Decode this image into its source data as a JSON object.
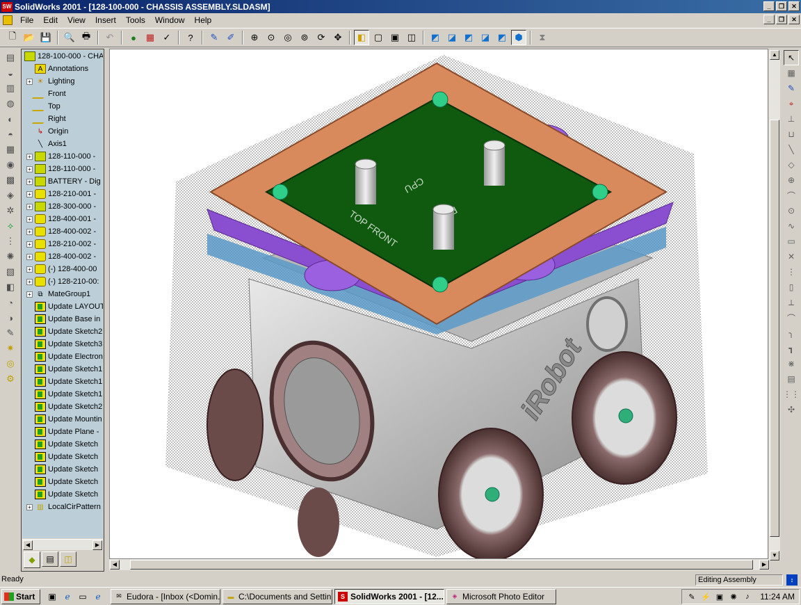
{
  "window": {
    "title": "SolidWorks 2001 - [128-100-000 - CHASSIS ASSEMBLY.SLDASM]",
    "app_icon": "SW"
  },
  "menu": [
    "File",
    "Edit",
    "View",
    "Insert",
    "Tools",
    "Window",
    "Help"
  ],
  "tree": {
    "root": "128-100-000 - CHA",
    "items": [
      {
        "label": "Annotations",
        "icon": "annotations-icon",
        "expand": false
      },
      {
        "label": "Lighting",
        "icon": "lighting-icon",
        "expand": true
      },
      {
        "label": "Front",
        "icon": "plane-icon",
        "expand": false
      },
      {
        "label": "Top",
        "icon": "plane-icon",
        "expand": false
      },
      {
        "label": "Right",
        "icon": "plane-icon",
        "expand": false
      },
      {
        "label": "Origin",
        "icon": "origin-icon",
        "expand": false
      },
      {
        "label": "Axis1",
        "icon": "axis-icon",
        "expand": false
      },
      {
        "label": "128-110-000 -",
        "icon": "subassembly-icon",
        "expand": true
      },
      {
        "label": "128-110-000 -",
        "icon": "subassembly-icon",
        "expand": true
      },
      {
        "label": "BATTERY - Dig",
        "icon": "subassembly-icon",
        "expand": true
      },
      {
        "label": "128-210-001 -",
        "icon": "part-icon",
        "expand": true
      },
      {
        "label": "128-300-000 -",
        "icon": "subassembly-icon",
        "expand": true
      },
      {
        "label": "128-400-001 -",
        "icon": "part-icon",
        "expand": true
      },
      {
        "label": "128-400-002 -",
        "icon": "part-icon",
        "expand": true
      },
      {
        "label": "128-210-002 -",
        "icon": "part-icon",
        "expand": true
      },
      {
        "label": "128-400-002 -",
        "icon": "part-icon",
        "expand": true
      },
      {
        "label": "(-) 128-400-00",
        "icon": "part-icon",
        "expand": true
      },
      {
        "label": "(-) 128-210-00:",
        "icon": "part-icon",
        "expand": true
      },
      {
        "label": "MateGroup1",
        "icon": "mategroup-icon",
        "expand": true
      },
      {
        "label": "Update LAYOUT",
        "icon": "update-icon",
        "expand": false
      },
      {
        "label": "Update Base in",
        "icon": "update-icon",
        "expand": false
      },
      {
        "label": "Update Sketch2",
        "icon": "update-icon",
        "expand": false
      },
      {
        "label": "Update Sketch3",
        "icon": "update-icon",
        "expand": false
      },
      {
        "label": "Update Electron",
        "icon": "update-icon",
        "expand": false
      },
      {
        "label": "Update Sketch1",
        "icon": "update-icon",
        "expand": false
      },
      {
        "label": "Update Sketch1",
        "icon": "update-icon",
        "expand": false
      },
      {
        "label": "Update Sketch1",
        "icon": "update-icon",
        "expand": false
      },
      {
        "label": "Update Sketch2",
        "icon": "update-icon",
        "expand": false
      },
      {
        "label": "Update Mountin",
        "icon": "update-icon",
        "expand": false
      },
      {
        "label": "Update Plane -",
        "icon": "update-icon",
        "expand": false
      },
      {
        "label": "Update Sketch",
        "icon": "update-icon",
        "expand": false
      },
      {
        "label": "Update Sketch",
        "icon": "update-icon",
        "expand": false
      },
      {
        "label": "Update Sketch",
        "icon": "update-icon",
        "expand": false
      },
      {
        "label": "Update Sketch",
        "icon": "update-icon",
        "expand": false
      },
      {
        "label": "Update Sketch",
        "icon": "update-icon",
        "expand": false
      },
      {
        "label": "LocalCirPattern",
        "icon": "pattern-icon",
        "expand": true
      }
    ]
  },
  "model": {
    "board_label_1": "TOP FRONT",
    "board_label_2": "CPU",
    "board_label_3": "R",
    "brand": "iRobot",
    "colors": {
      "board": "#0f5a0f",
      "frame": "#d98a5c",
      "plate": "#8a4fd0",
      "body": "#c8c8c8",
      "tire": "#6b4a4a"
    }
  },
  "status": {
    "left": "Ready",
    "mode": "Editing Assembly"
  },
  "taskbar": {
    "start": "Start",
    "tasks": [
      {
        "label": "Eudora - [Inbox (<Domin...",
        "active": false
      },
      {
        "label": "C:\\Documents and Settin...",
        "active": false
      },
      {
        "label": "SolidWorks 2001 - [12...",
        "active": true
      },
      {
        "label": "Microsoft Photo Editor",
        "active": false
      }
    ],
    "clock": "11:24 AM"
  }
}
